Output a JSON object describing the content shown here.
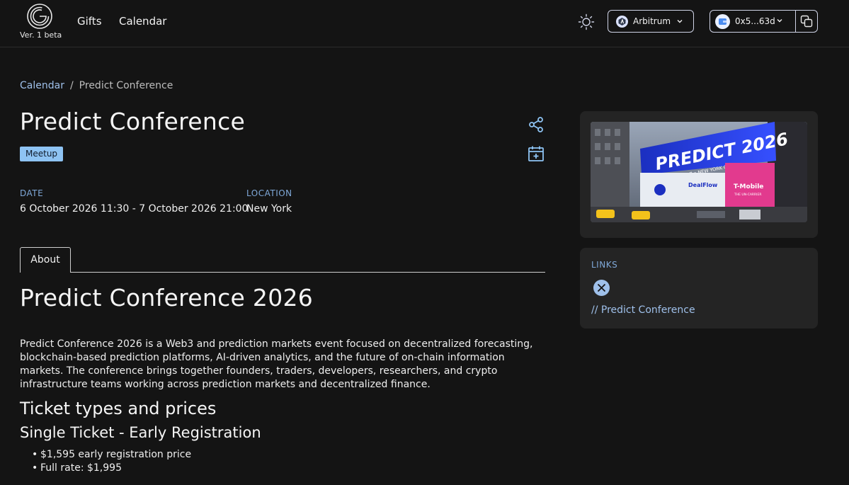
{
  "header": {
    "version": "Ver. 1 beta",
    "nav": [
      {
        "label": "Gifts"
      },
      {
        "label": "Calendar"
      }
    ],
    "network": {
      "label": "Arbitrum",
      "icon": "arbitrum-icon"
    },
    "wallet": {
      "address": "0x5...63d",
      "icon": "wallet-avatar-icon"
    }
  },
  "breadcrumb": {
    "parent": "Calendar",
    "separator": "/",
    "current": "Predict Conference"
  },
  "event": {
    "title": "Predict Conference",
    "badge": "Meetup",
    "date_label": "DATE",
    "date_value": "6 October 2026 11:30 - 7 October 2026 21:00",
    "location_label": "LOCATION",
    "location_value": "New York"
  },
  "tabs": [
    {
      "label": "About"
    }
  ],
  "about": {
    "title": "Predict Conference 2026",
    "description": "Predict Conference 2026 is a Web3 and prediction markets event focused on decentralized forecasting, blockchain-based prediction platforms, AI-driven analytics, and the future of on-chain information markets. The conference brings together founders, traders, developers, researchers, and crypto infrastructure teams working across prediction markets and decentralized finance.",
    "tickets_heading": "Ticket types and prices",
    "ticket_type": "Single Ticket - Early Registration",
    "prices": [
      "$1,595 early registration price",
      "Full rate: $1,995"
    ]
  },
  "image_card": {
    "billboard_title": "PREDICT 2026",
    "billboard_sub": "OCTOBER 6-7 • NEW YORK CITY",
    "ad_brand": "T-Mobile",
    "ad_sub": "THE UN-CARRIER",
    "screen_text": "DealFlow"
  },
  "links": {
    "label": "LINKS",
    "items": [
      {
        "text": "// Predict Conference",
        "icon": "x-icon"
      }
    ]
  },
  "colors": {
    "background": "#141414",
    "card": "#242424",
    "accent": "#9fc0ea",
    "badge": "#8ec3f3"
  }
}
